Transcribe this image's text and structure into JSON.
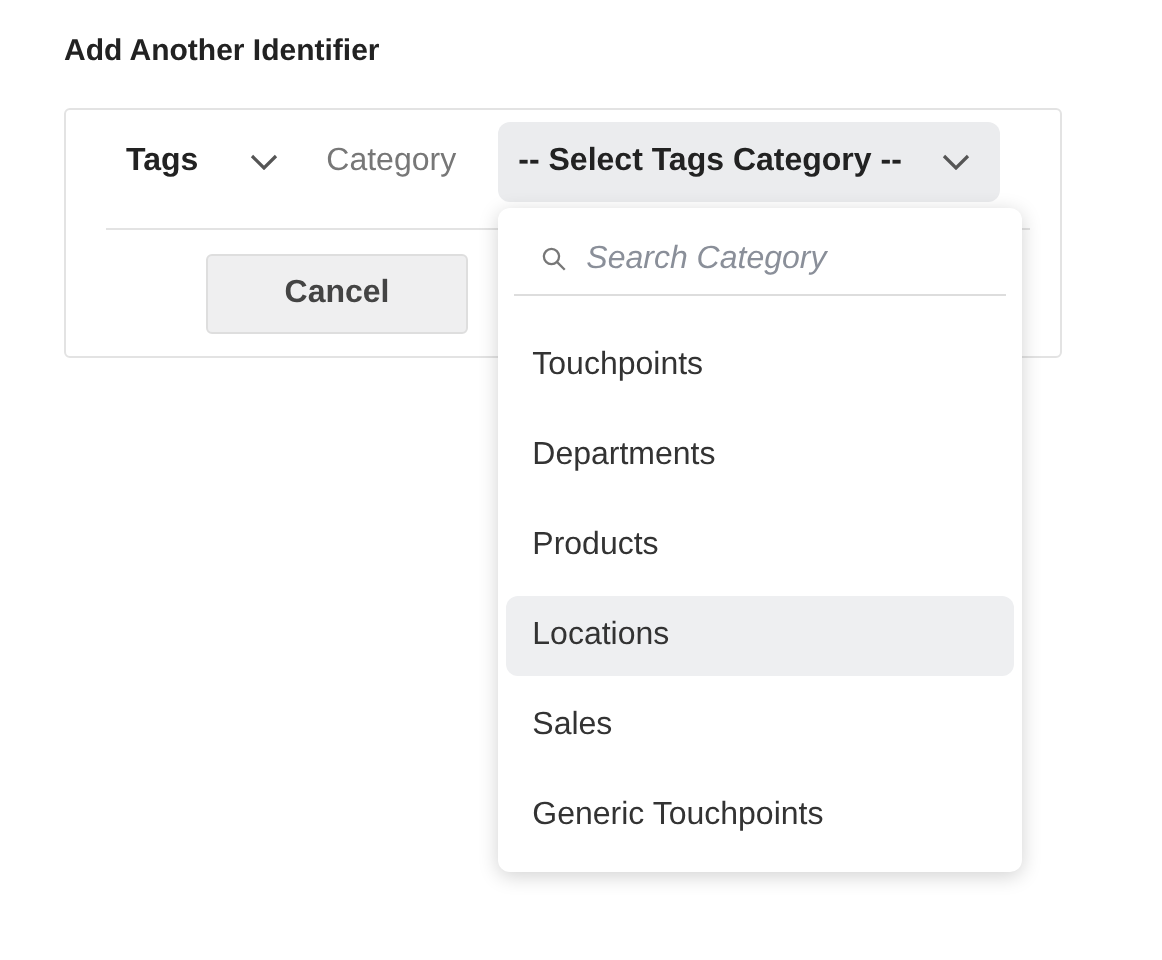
{
  "title": "Add Another Identifier",
  "identifier": {
    "type_select": {
      "value": "Tags"
    },
    "category_label": "Category",
    "category_select": {
      "value": "-- Select Tags Category --",
      "expanded": true
    },
    "cancel_button": "Cancel"
  },
  "dropdown": {
    "search": {
      "placeholder": "Search Category"
    },
    "items": [
      {
        "label": "Touchpoints",
        "selected": false
      },
      {
        "label": "Departments",
        "selected": false
      },
      {
        "label": "Products",
        "selected": false
      },
      {
        "label": "Locations",
        "selected": true
      },
      {
        "label": "Sales",
        "selected": false
      },
      {
        "label": "Generic Touchpoints",
        "selected": false
      }
    ]
  }
}
